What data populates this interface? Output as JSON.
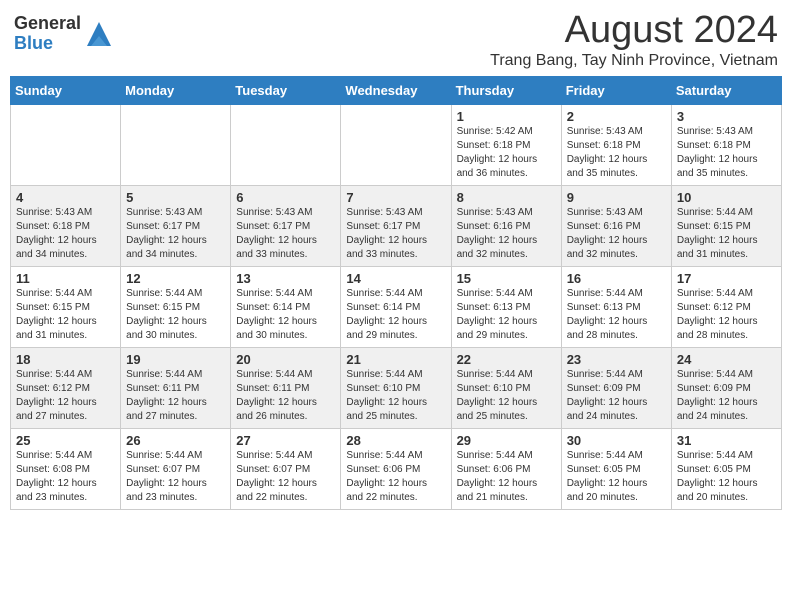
{
  "logo": {
    "general": "General",
    "blue": "Blue"
  },
  "title": "August 2024",
  "subtitle": "Trang Bang, Tay Ninh Province, Vietnam",
  "days_of_week": [
    "Sunday",
    "Monday",
    "Tuesday",
    "Wednesday",
    "Thursday",
    "Friday",
    "Saturday"
  ],
  "weeks": [
    [
      {
        "day": "",
        "info": ""
      },
      {
        "day": "",
        "info": ""
      },
      {
        "day": "",
        "info": ""
      },
      {
        "day": "",
        "info": ""
      },
      {
        "day": "1",
        "info": "Sunrise: 5:42 AM\nSunset: 6:18 PM\nDaylight: 12 hours and 36 minutes."
      },
      {
        "day": "2",
        "info": "Sunrise: 5:43 AM\nSunset: 6:18 PM\nDaylight: 12 hours and 35 minutes."
      },
      {
        "day": "3",
        "info": "Sunrise: 5:43 AM\nSunset: 6:18 PM\nDaylight: 12 hours and 35 minutes."
      }
    ],
    [
      {
        "day": "4",
        "info": "Sunrise: 5:43 AM\nSunset: 6:18 PM\nDaylight: 12 hours and 34 minutes."
      },
      {
        "day": "5",
        "info": "Sunrise: 5:43 AM\nSunset: 6:17 PM\nDaylight: 12 hours and 34 minutes."
      },
      {
        "day": "6",
        "info": "Sunrise: 5:43 AM\nSunset: 6:17 PM\nDaylight: 12 hours and 33 minutes."
      },
      {
        "day": "7",
        "info": "Sunrise: 5:43 AM\nSunset: 6:17 PM\nDaylight: 12 hours and 33 minutes."
      },
      {
        "day": "8",
        "info": "Sunrise: 5:43 AM\nSunset: 6:16 PM\nDaylight: 12 hours and 32 minutes."
      },
      {
        "day": "9",
        "info": "Sunrise: 5:43 AM\nSunset: 6:16 PM\nDaylight: 12 hours and 32 minutes."
      },
      {
        "day": "10",
        "info": "Sunrise: 5:44 AM\nSunset: 6:15 PM\nDaylight: 12 hours and 31 minutes."
      }
    ],
    [
      {
        "day": "11",
        "info": "Sunrise: 5:44 AM\nSunset: 6:15 PM\nDaylight: 12 hours and 31 minutes."
      },
      {
        "day": "12",
        "info": "Sunrise: 5:44 AM\nSunset: 6:15 PM\nDaylight: 12 hours and 30 minutes."
      },
      {
        "day": "13",
        "info": "Sunrise: 5:44 AM\nSunset: 6:14 PM\nDaylight: 12 hours and 30 minutes."
      },
      {
        "day": "14",
        "info": "Sunrise: 5:44 AM\nSunset: 6:14 PM\nDaylight: 12 hours and 29 minutes."
      },
      {
        "day": "15",
        "info": "Sunrise: 5:44 AM\nSunset: 6:13 PM\nDaylight: 12 hours and 29 minutes."
      },
      {
        "day": "16",
        "info": "Sunrise: 5:44 AM\nSunset: 6:13 PM\nDaylight: 12 hours and 28 minutes."
      },
      {
        "day": "17",
        "info": "Sunrise: 5:44 AM\nSunset: 6:12 PM\nDaylight: 12 hours and 28 minutes."
      }
    ],
    [
      {
        "day": "18",
        "info": "Sunrise: 5:44 AM\nSunset: 6:12 PM\nDaylight: 12 hours and 27 minutes."
      },
      {
        "day": "19",
        "info": "Sunrise: 5:44 AM\nSunset: 6:11 PM\nDaylight: 12 hours and 27 minutes."
      },
      {
        "day": "20",
        "info": "Sunrise: 5:44 AM\nSunset: 6:11 PM\nDaylight: 12 hours and 26 minutes."
      },
      {
        "day": "21",
        "info": "Sunrise: 5:44 AM\nSunset: 6:10 PM\nDaylight: 12 hours and 25 minutes."
      },
      {
        "day": "22",
        "info": "Sunrise: 5:44 AM\nSunset: 6:10 PM\nDaylight: 12 hours and 25 minutes."
      },
      {
        "day": "23",
        "info": "Sunrise: 5:44 AM\nSunset: 6:09 PM\nDaylight: 12 hours and 24 minutes."
      },
      {
        "day": "24",
        "info": "Sunrise: 5:44 AM\nSunset: 6:09 PM\nDaylight: 12 hours and 24 minutes."
      }
    ],
    [
      {
        "day": "25",
        "info": "Sunrise: 5:44 AM\nSunset: 6:08 PM\nDaylight: 12 hours and 23 minutes."
      },
      {
        "day": "26",
        "info": "Sunrise: 5:44 AM\nSunset: 6:07 PM\nDaylight: 12 hours and 23 minutes."
      },
      {
        "day": "27",
        "info": "Sunrise: 5:44 AM\nSunset: 6:07 PM\nDaylight: 12 hours and 22 minutes."
      },
      {
        "day": "28",
        "info": "Sunrise: 5:44 AM\nSunset: 6:06 PM\nDaylight: 12 hours and 22 minutes."
      },
      {
        "day": "29",
        "info": "Sunrise: 5:44 AM\nSunset: 6:06 PM\nDaylight: 12 hours and 21 minutes."
      },
      {
        "day": "30",
        "info": "Sunrise: 5:44 AM\nSunset: 6:05 PM\nDaylight: 12 hours and 20 minutes."
      },
      {
        "day": "31",
        "info": "Sunrise: 5:44 AM\nSunset: 6:05 PM\nDaylight: 12 hours and 20 minutes."
      }
    ]
  ]
}
